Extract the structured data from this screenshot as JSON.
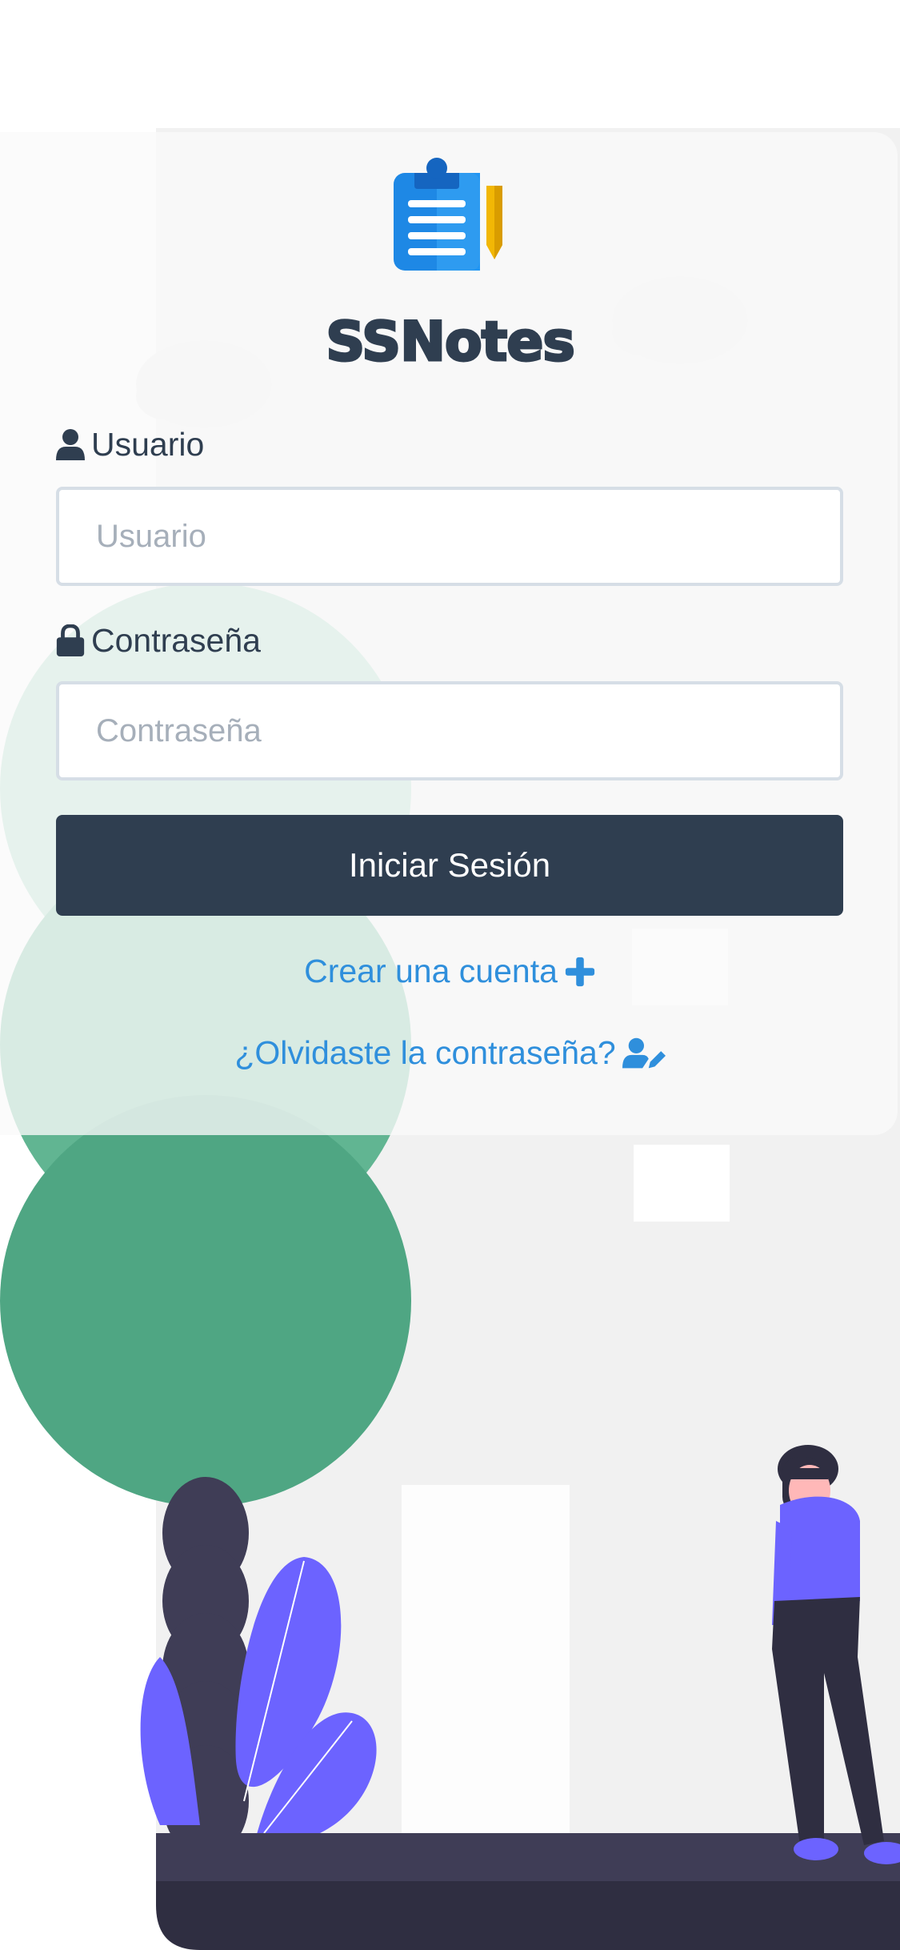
{
  "app": {
    "name": "SSNotes"
  },
  "form": {
    "username_label": "Usuario",
    "username_placeholder": "Usuario",
    "username_value": "",
    "password_label": "Contraseña",
    "password_placeholder": "Contraseña",
    "password_value": "",
    "login_button": "Iniciar Sesión"
  },
  "links": {
    "create_account": "Crear una cuenta",
    "forgot_password": "¿Olvidaste la contraseña?"
  },
  "icons": {
    "logo": "clipboard-pencil-icon",
    "username": "user-icon",
    "password": "lock-icon",
    "create_account": "plus-icon",
    "forgot_password": "user-edit-icon"
  },
  "colors": {
    "primary_dark": "#2f3e50",
    "link": "#2f8fdc",
    "tree_green": "#4fa683",
    "accent_purple": "#6c63ff"
  }
}
